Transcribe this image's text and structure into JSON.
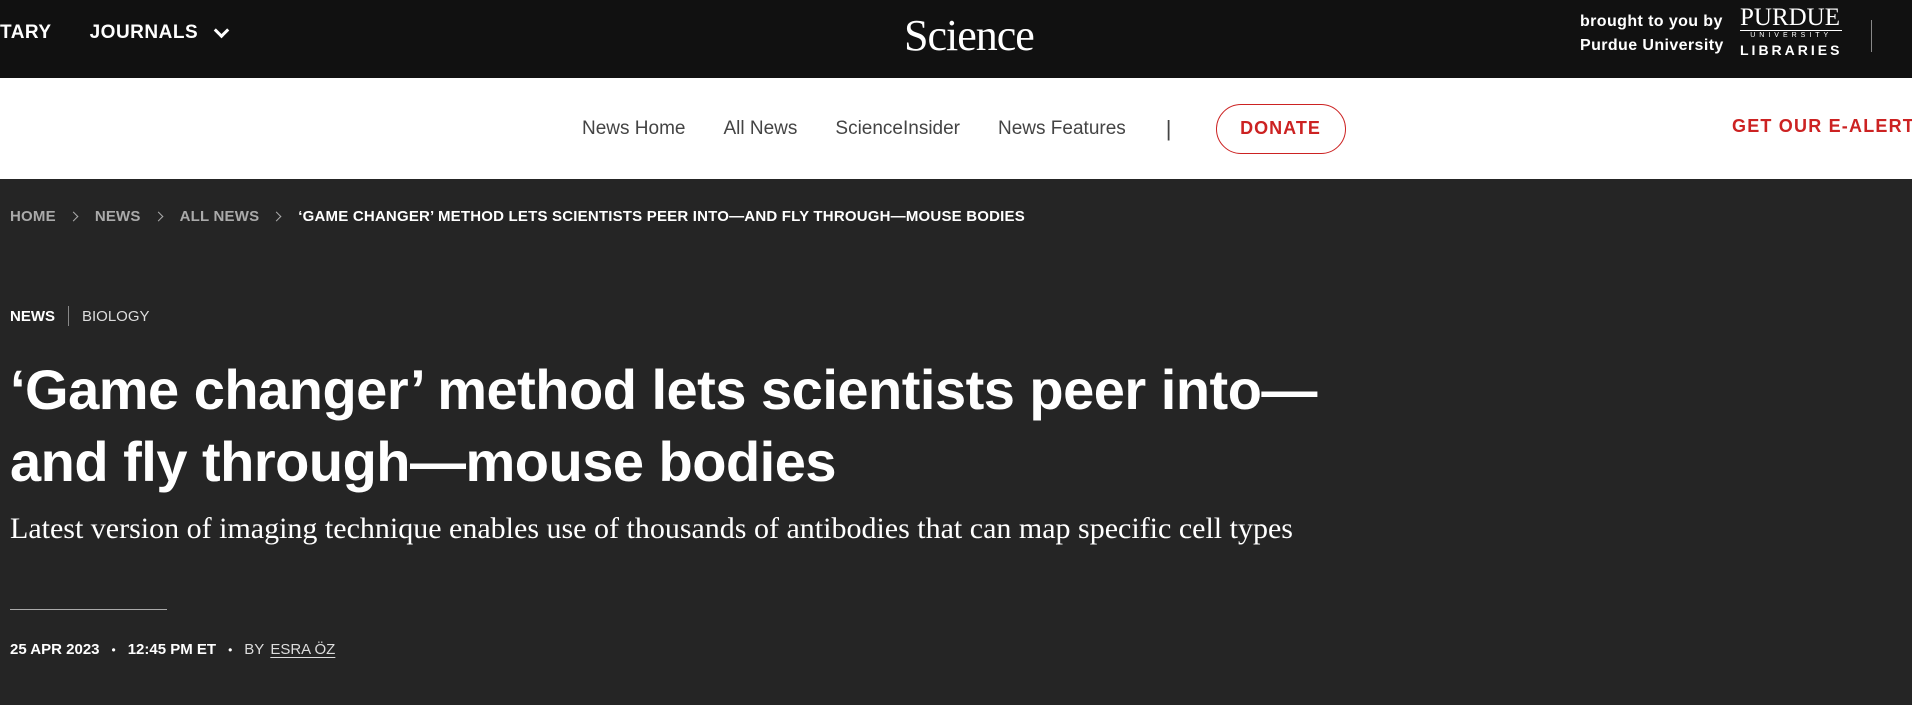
{
  "topbar": {
    "left_items": [
      "TARY",
      "JOURNALS"
    ],
    "logo": "Science",
    "sponsor_line1": "brought to you by",
    "sponsor_line2": "Purdue University",
    "purdue_word": "PURDUE",
    "purdue_uni": "UNIVERSITY",
    "purdue_lib": "LIBRARIES"
  },
  "nav": {
    "links": [
      "News Home",
      "All News",
      "ScienceInsider",
      "News Features"
    ],
    "separator": "|",
    "donate": "DONATE",
    "ealert": "GET OUR E-ALERT"
  },
  "breadcrumb": {
    "items": [
      "HOME",
      "NEWS",
      "ALL NEWS"
    ],
    "current": "‘GAME CHANGER’ METHOD LETS SCIENTISTS PEER INTO—AND FLY THROUGH—MOUSE BODIES"
  },
  "article": {
    "section": "NEWS",
    "topic": "BIOLOGY",
    "headline": "‘Game changer’ method lets scientists peer into—and fly through—mouse bodies",
    "dek": "Latest version of imaging technique enables use of thousands of antibodies that can map specific cell types",
    "date": "25 APR 2023",
    "time": "12:45 PM ET",
    "by": "BY",
    "author": "ESRA ÖZ"
  },
  "colors": {
    "accent": "#c22222",
    "topbar": "#111111",
    "hero_bg": "#252525"
  }
}
